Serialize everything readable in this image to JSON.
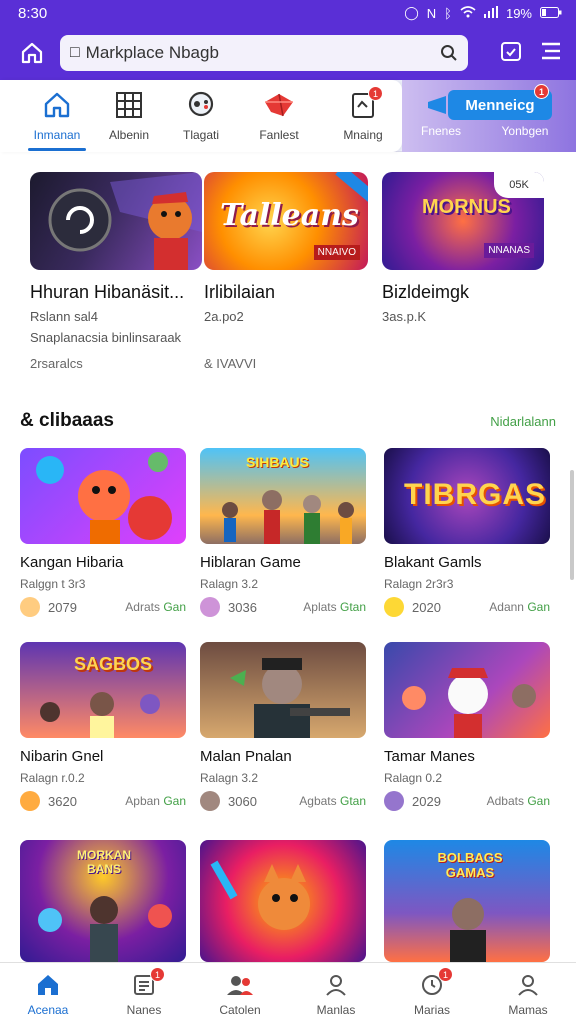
{
  "status": {
    "time": "8:30",
    "battery": "19%"
  },
  "search": {
    "text": "Markplace Nbagb"
  },
  "categories": [
    {
      "label": "Inmanan",
      "icon": "home-icon",
      "active": true
    },
    {
      "label": "Albenin",
      "icon": "grid-icon",
      "active": false
    },
    {
      "label": "Tlagati",
      "icon": "controller-icon",
      "active": false
    },
    {
      "label": "Fanlest",
      "icon": "gem-icon",
      "active": false
    },
    {
      "label": "Mnaing",
      "icon": "clipboard-icon",
      "active": false,
      "badge": "1"
    },
    {
      "label": "Fnenes",
      "icon": "promo-icon",
      "active": false
    },
    {
      "label": "Yonbgen",
      "icon": "promo-icon",
      "active": false
    }
  ],
  "promo": {
    "label": "Menneicg",
    "badge": "1"
  },
  "featured": [
    {
      "title": "Hhuran Hibanäsit...",
      "sub1": "Rslann sal4",
      "sub2": "Snaplanacsia binlinsaraak",
      "meta": "2rsaralcs",
      "img_badge": ""
    },
    {
      "title": "Irlibilaian",
      "sub1": "2a.po2",
      "sub2": "",
      "meta": "& IVAVVI",
      "img_text": "Talleans",
      "img_badge": "NNAIVO"
    },
    {
      "title": "Bizldeimgk",
      "sub1": "3as.p.K",
      "sub2": "",
      "meta": "",
      "img_text": "MORNUS",
      "img_badge": "NNANAS",
      "corner": "05K"
    }
  ],
  "section": {
    "title": "& clibaaas",
    "see_all": "Nidarlalann"
  },
  "games": [
    {
      "title": "Kangan Hibaria",
      "rating": "Ralggn t 3r3",
      "count": "2079",
      "action": "Adrats",
      "action_hl": "Gan",
      "img_text": ""
    },
    {
      "title": "Hiblaran Game",
      "rating": "Ralagn 3.2",
      "count": "3036",
      "action": "Aplats",
      "action_hl": "Gtan",
      "img_text": "SIHBAUS"
    },
    {
      "title": "Blakant Gamls",
      "rating": "Ralagn 2r3r3",
      "count": "2020",
      "action": "Adann",
      "action_hl": "Gan",
      "img_text": "TIBRGAS"
    },
    {
      "title": "Nibarin Gnel",
      "rating": "Ralagn r.0.2",
      "count": "3620",
      "action": "Apban",
      "action_hl": "Gan",
      "img_text": "SAGBOS"
    },
    {
      "title": "Malan Pnalan",
      "rating": "Ralagn 3.2",
      "count": "3060",
      "action": "Agbats",
      "action_hl": "Gtan",
      "img_text": ""
    },
    {
      "title": "Tamar Manes",
      "rating": "Ralagn 0.2",
      "count": "2029",
      "action": "Adbats",
      "action_hl": "Gan",
      "img_text": ""
    },
    {
      "title": "",
      "rating": "",
      "count": "",
      "action": "",
      "action_hl": "",
      "img_text": "MORKAN BANS"
    },
    {
      "title": "",
      "rating": "",
      "count": "",
      "action": "",
      "action_hl": "",
      "img_text": ""
    },
    {
      "title": "",
      "rating": "",
      "count": "",
      "action": "",
      "action_hl": "",
      "img_text": "BOLBAGS GAMAS"
    }
  ],
  "bottom_nav": [
    {
      "label": "Acenaa",
      "icon": "home-icon",
      "active": true
    },
    {
      "label": "Nanes",
      "icon": "list-icon",
      "badge": "1"
    },
    {
      "label": "Catolen",
      "icon": "people-icon"
    },
    {
      "label": "Manlas",
      "icon": "person-icon"
    },
    {
      "label": "Marias",
      "icon": "clock-icon",
      "badge": "1"
    },
    {
      "label": "Mamas",
      "icon": "account-icon"
    }
  ],
  "colors": {
    "brand": "#5a2fd6",
    "accent": "#1b6fd1",
    "success": "#43a047",
    "badge": "#e53935"
  }
}
